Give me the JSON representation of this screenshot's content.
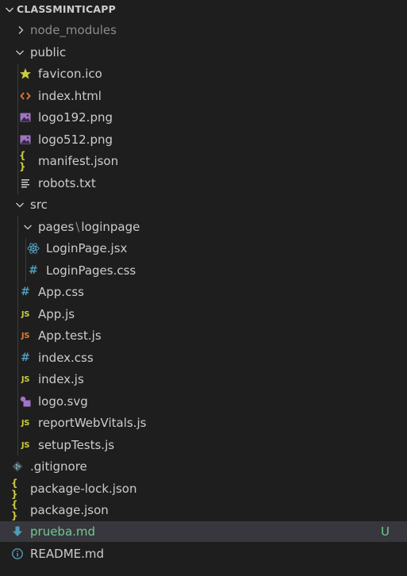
{
  "explorer": {
    "title": "CLASSMINTICAPP",
    "badge_untracked": "U",
    "colors": {
      "background": "#1e1e1e",
      "selected_row": "#37373d",
      "text": "#cccccc",
      "untracked": "#73c991"
    },
    "items": [
      {
        "label": "node_modules",
        "type": "folder",
        "state": "collapsed",
        "icon": "chevron-right-icon"
      },
      {
        "label": "public",
        "type": "folder",
        "state": "expanded",
        "icon": "chevron-down-icon"
      },
      {
        "label": "favicon.ico",
        "type": "file",
        "icon": "star-icon"
      },
      {
        "label": "index.html",
        "type": "file",
        "icon": "html-code-icon"
      },
      {
        "label": "logo192.png",
        "type": "file",
        "icon": "image-icon"
      },
      {
        "label": "logo512.png",
        "type": "file",
        "icon": "image-icon"
      },
      {
        "label": "manifest.json",
        "type": "file",
        "icon": "json-braces-icon"
      },
      {
        "label": "robots.txt",
        "type": "file",
        "icon": "text-lines-icon"
      },
      {
        "label": "src",
        "type": "folder",
        "state": "expanded",
        "icon": "chevron-down-icon"
      },
      {
        "label": "pages",
        "label_sep": "\\",
        "label_rest": "loginpage",
        "type": "folder",
        "state": "expanded",
        "icon": "chevron-down-icon"
      },
      {
        "label": "LoginPage.jsx",
        "type": "file",
        "icon": "react-icon"
      },
      {
        "label": "LoginPages.css",
        "type": "file",
        "icon": "css-hash-icon"
      },
      {
        "label": "App.css",
        "type": "file",
        "icon": "css-hash-icon"
      },
      {
        "label": "App.js",
        "type": "file",
        "icon": "js-icon"
      },
      {
        "label": "App.test.js",
        "type": "file",
        "icon": "js-test-icon"
      },
      {
        "label": "index.css",
        "type": "file",
        "icon": "css-hash-icon"
      },
      {
        "label": "index.js",
        "type": "file",
        "icon": "js-icon"
      },
      {
        "label": "logo.svg",
        "type": "file",
        "icon": "svg-shapes-icon"
      },
      {
        "label": "reportWebVitals.js",
        "type": "file",
        "icon": "js-icon"
      },
      {
        "label": "setupTests.js",
        "type": "file",
        "icon": "js-icon"
      },
      {
        "label": ".gitignore",
        "type": "file",
        "icon": "git-icon"
      },
      {
        "label": "package-lock.json",
        "type": "file",
        "icon": "json-braces-icon"
      },
      {
        "label": "package.json",
        "type": "file",
        "icon": "json-braces-icon"
      },
      {
        "label": "prueba.md",
        "type": "file",
        "icon": "markdown-download-icon",
        "git_status": "U",
        "selected": true
      },
      {
        "label": "README.md",
        "type": "file",
        "icon": "info-icon"
      }
    ]
  }
}
